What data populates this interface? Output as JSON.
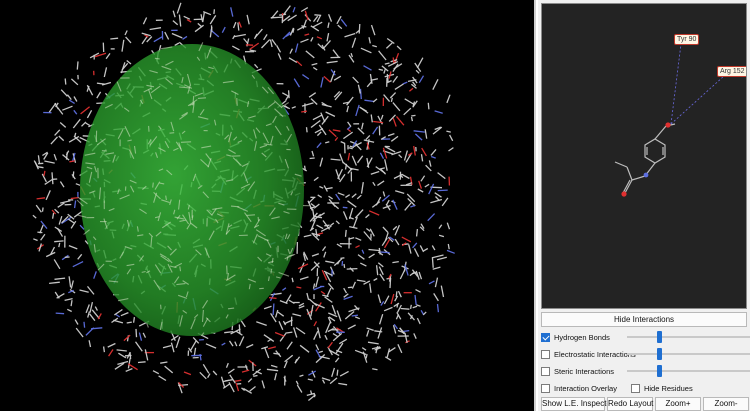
{
  "scene": {
    "background": "#000000",
    "envelope_color": "#2fa531",
    "atom_colors": {
      "carbon": "#cfcfcf",
      "oxygen": "#e03030",
      "nitrogen": "#5d6fe0"
    }
  },
  "ligand_view": {
    "background": "#232323",
    "residues": [
      {
        "label": "Tyr 90"
      },
      {
        "label": "Arg 152"
      }
    ],
    "interaction_line_color": "#6a6ae0"
  },
  "controls": {
    "hide_interactions_label": "Hide Interactions",
    "hydrogen_bonds": {
      "label": "Hydrogen Bonds",
      "checked": true,
      "level": 0.25
    },
    "electrostatic": {
      "label": "Electrostatic Interactions",
      "checked": false,
      "level": 0.25
    },
    "steric": {
      "label": "Steric Interactions",
      "checked": false,
      "level": 0.25
    },
    "interaction_overlay": {
      "label": "Interaction Overlay",
      "checked": false
    },
    "hide_residues": {
      "label": "Hide Residues",
      "checked": false
    }
  },
  "buttons": {
    "show_inspector": "Show L.E. Inspector",
    "redo_layout": "Redo Layout",
    "zoom_in": "Zoom+",
    "zoom_out": "Zoom-"
  },
  "accent_color": "#1f6fd1"
}
